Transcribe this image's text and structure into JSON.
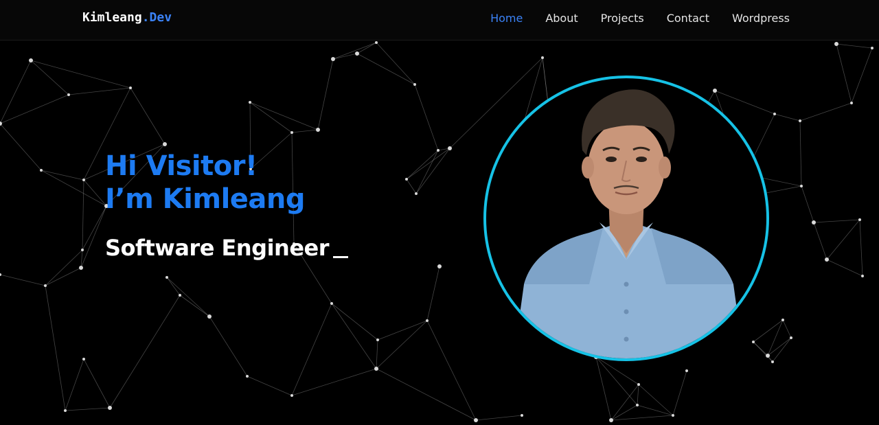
{
  "header": {
    "brand_name": "Kimleang",
    "brand_tld": ".Dev",
    "nav": [
      {
        "label": "Home",
        "active": true
      },
      {
        "label": "About",
        "active": false
      },
      {
        "label": "Projects",
        "active": false
      },
      {
        "label": "Contact",
        "active": false
      },
      {
        "label": "Wordpress",
        "active": false
      }
    ]
  },
  "hero": {
    "greeting_line1": "Hi Visitor!",
    "greeting_line2": "I’m Kimleang",
    "role": "Software Engineer"
  },
  "colors": {
    "accent": "#3b82f6",
    "greeting": "#1d7bf2",
    "avatar_ring": "#16c2e6",
    "background": "#000000"
  },
  "icons": {
    "avatar": "portrait-photo"
  }
}
